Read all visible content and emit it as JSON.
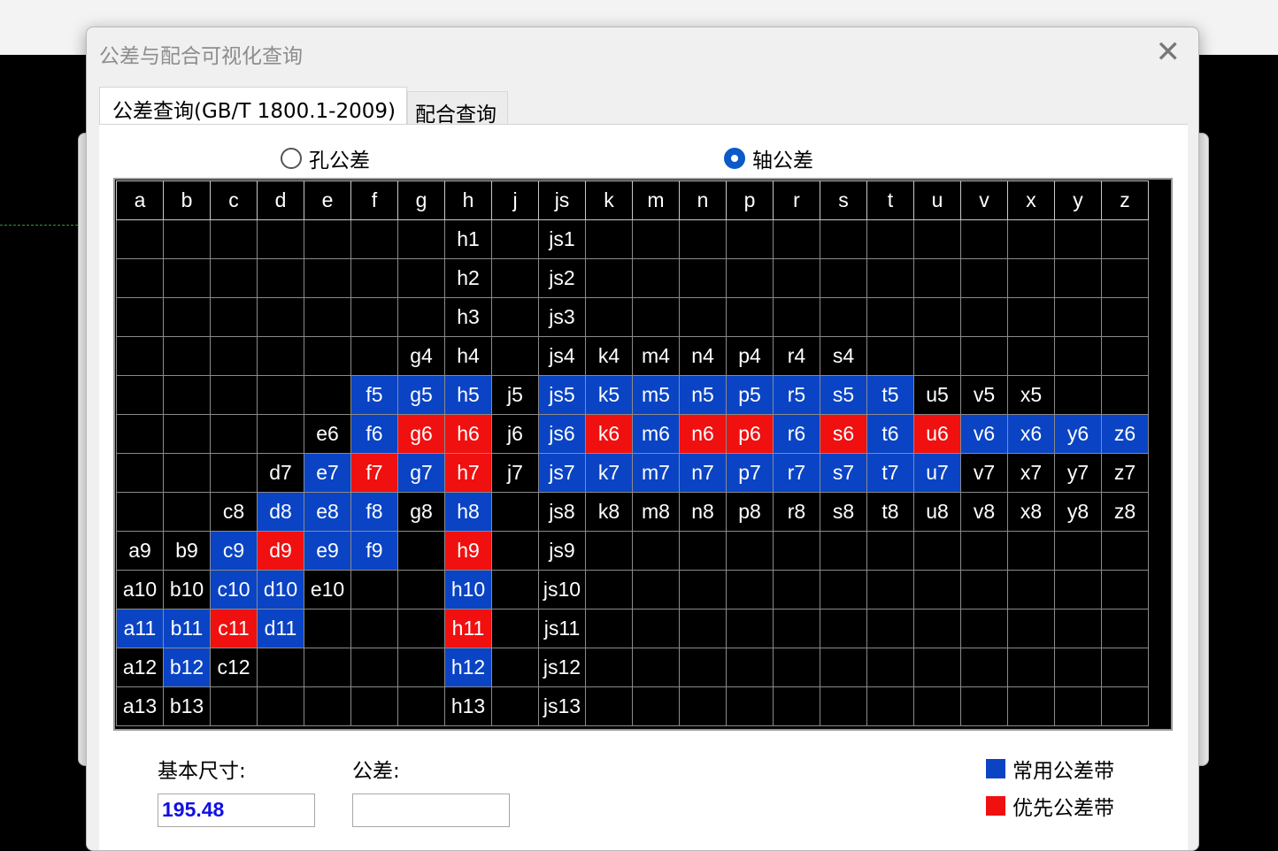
{
  "window": {
    "title": "公差与配合可视化查询",
    "close_glyph": "✕"
  },
  "tabs": [
    {
      "label": "公差查询(GB/T 1800.1-2009)",
      "active": true
    },
    {
      "label": "配合查询",
      "active": false
    }
  ],
  "radios": [
    {
      "label": "孔公差",
      "checked": false
    },
    {
      "label": "轴公差",
      "checked": true
    }
  ],
  "grid": {
    "columns": [
      "a",
      "b",
      "c",
      "d",
      "e",
      "f",
      "g",
      "h",
      "j",
      "js",
      "k",
      "m",
      "n",
      "p",
      "r",
      "s",
      "t",
      "u",
      "v",
      "x",
      "y",
      "z"
    ],
    "rows": [
      [
        "",
        "",
        "",
        "",
        "",
        "",
        "",
        "h1",
        "",
        "js1",
        "",
        "",
        "",
        "",
        "",
        "",
        "",
        "",
        "",
        "",
        "",
        ""
      ],
      [
        "",
        "",
        "",
        "",
        "",
        "",
        "",
        "h2",
        "",
        "js2",
        "",
        "",
        "",
        "",
        "",
        "",
        "",
        "",
        "",
        "",
        "",
        ""
      ],
      [
        "",
        "",
        "",
        "",
        "",
        "",
        "",
        "h3",
        "",
        "js3",
        "",
        "",
        "",
        "",
        "",
        "",
        "",
        "",
        "",
        "",
        "",
        ""
      ],
      [
        "",
        "",
        "",
        "",
        "",
        "",
        "g4",
        "h4",
        "",
        "js4",
        "k4",
        "m4",
        "n4",
        "p4",
        "r4",
        "s4",
        "",
        "",
        "",
        "",
        "",
        ""
      ],
      [
        "",
        "",
        "",
        "",
        "",
        "f5",
        "g5",
        "h5",
        "j5",
        "js5",
        "k5",
        "m5",
        "n5",
        "p5",
        "r5",
        "s5",
        "t5",
        "u5",
        "v5",
        "x5",
        "",
        ""
      ],
      [
        "",
        "",
        "",
        "",
        "e6",
        "f6",
        "g6",
        "h6",
        "j6",
        "js6",
        "k6",
        "m6",
        "n6",
        "p6",
        "r6",
        "s6",
        "t6",
        "u6",
        "v6",
        "x6",
        "y6",
        "z6"
      ],
      [
        "",
        "",
        "",
        "d7",
        "e7",
        "f7",
        "g7",
        "h7",
        "j7",
        "js7",
        "k7",
        "m7",
        "n7",
        "p7",
        "r7",
        "s7",
        "t7",
        "u7",
        "v7",
        "x7",
        "y7",
        "z7"
      ],
      [
        "",
        "",
        "c8",
        "d8",
        "e8",
        "f8",
        "g8",
        "h8",
        "",
        "js8",
        "k8",
        "m8",
        "n8",
        "p8",
        "r8",
        "s8",
        "t8",
        "u8",
        "v8",
        "x8",
        "y8",
        "z8"
      ],
      [
        "a9",
        "b9",
        "c9",
        "d9",
        "e9",
        "f9",
        "",
        "h9",
        "",
        "js9",
        "",
        "",
        "",
        "",
        "",
        "",
        "",
        "",
        "",
        "",
        "",
        ""
      ],
      [
        "a10",
        "b10",
        "c10",
        "d10",
        "e10",
        "",
        "",
        "h10",
        "",
        "js10",
        "",
        "",
        "",
        "",
        "",
        "",
        "",
        "",
        "",
        "",
        "",
        ""
      ],
      [
        "a11",
        "b11",
        "c11",
        "d11",
        "",
        "",
        "",
        "h11",
        "",
        "js11",
        "",
        "",
        "",
        "",
        "",
        "",
        "",
        "",
        "",
        "",
        "",
        ""
      ],
      [
        "a12",
        "b12",
        "c12",
        "",
        "",
        "",
        "",
        "h12",
        "",
        "js12",
        "",
        "",
        "",
        "",
        "",
        "",
        "",
        "",
        "",
        "",
        "",
        ""
      ],
      [
        "a13",
        "b13",
        "",
        "",
        "",
        "",
        "",
        "h13",
        "",
        "js13",
        "",
        "",
        "",
        "",
        "",
        "",
        "",
        "",
        "",
        "",
        "",
        ""
      ]
    ],
    "common_zones": [
      "f5",
      "g5",
      "h5",
      "js5",
      "k5",
      "m5",
      "n5",
      "p5",
      "r5",
      "s5",
      "t5",
      "f6",
      "js6",
      "m6",
      "r6",
      "t6",
      "v6",
      "x6",
      "y6",
      "z6",
      "e7",
      "g7",
      "js7",
      "k7",
      "m7",
      "n7",
      "p7",
      "r7",
      "s7",
      "t7",
      "u7",
      "d8",
      "e8",
      "f8",
      "h8",
      "c9",
      "e9",
      "f9",
      "c10",
      "d10",
      "h10",
      "a11",
      "b11",
      "d11",
      "b12",
      "h12"
    ],
    "preferred_zones": [
      "g6",
      "h6",
      "k6",
      "n6",
      "p6",
      "s6",
      "u6",
      "f7",
      "h7",
      "d9",
      "h9",
      "c11",
      "h11"
    ]
  },
  "fields": {
    "basic_size_label": "基本尺寸:",
    "basic_size_value": "195.48",
    "tolerance_label": "公差:",
    "tolerance_value": ""
  },
  "legend": [
    {
      "label": "常用公差带",
      "color": "#0a44c4"
    },
    {
      "label": "优先公差带",
      "color": "#f01010"
    }
  ],
  "colors": {
    "common": "#0a44c4",
    "preferred": "#f01010",
    "radio_accent": "#0b5ac8",
    "value_text": "#1010e0"
  }
}
